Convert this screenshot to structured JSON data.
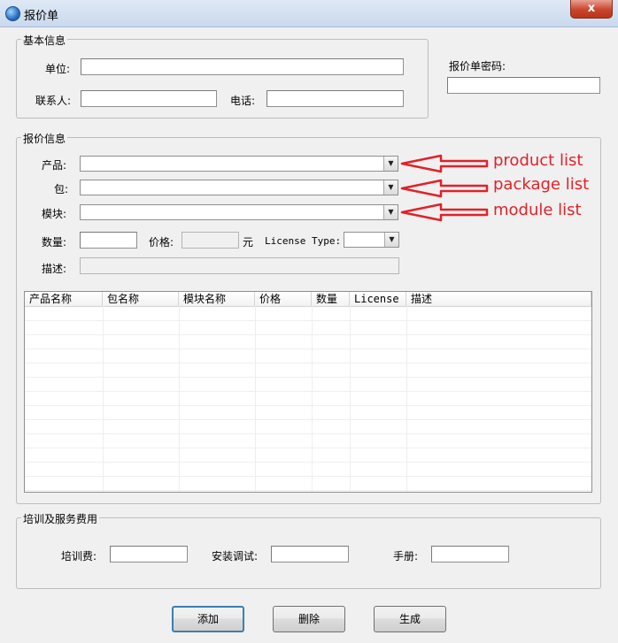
{
  "window": {
    "title": "报价单",
    "close_glyph": "x"
  },
  "basic_info": {
    "legend": "基本信息",
    "unit_label": "单位:",
    "unit_value": "",
    "contact_label": "联系人:",
    "contact_value": "",
    "phone_label": "电话:",
    "phone_value": ""
  },
  "quote_password": {
    "label": "报价单密码:",
    "value": ""
  },
  "quote_info": {
    "legend": "报价信息",
    "product_label": "产品:",
    "package_label": "包:",
    "module_label": "模块:",
    "quantity_label": "数量:",
    "price_label": "价格:",
    "currency_unit": "元",
    "license_type_label": "License Type:",
    "description_label": "描述:"
  },
  "annotations": {
    "product": "product list",
    "package": "package list",
    "module": "module list",
    "color": "#e0222a"
  },
  "table": {
    "columns": [
      "产品名称",
      "包名称",
      "模块名称",
      "价格",
      "数量",
      "License",
      "描述"
    ],
    "rows": []
  },
  "fees": {
    "legend": "培训及服务费用",
    "training_label": "培训费:",
    "install_label": "安装调试:",
    "manual_label": "手册:"
  },
  "buttons": {
    "add": "添加",
    "delete": "删除",
    "generate": "生成"
  }
}
